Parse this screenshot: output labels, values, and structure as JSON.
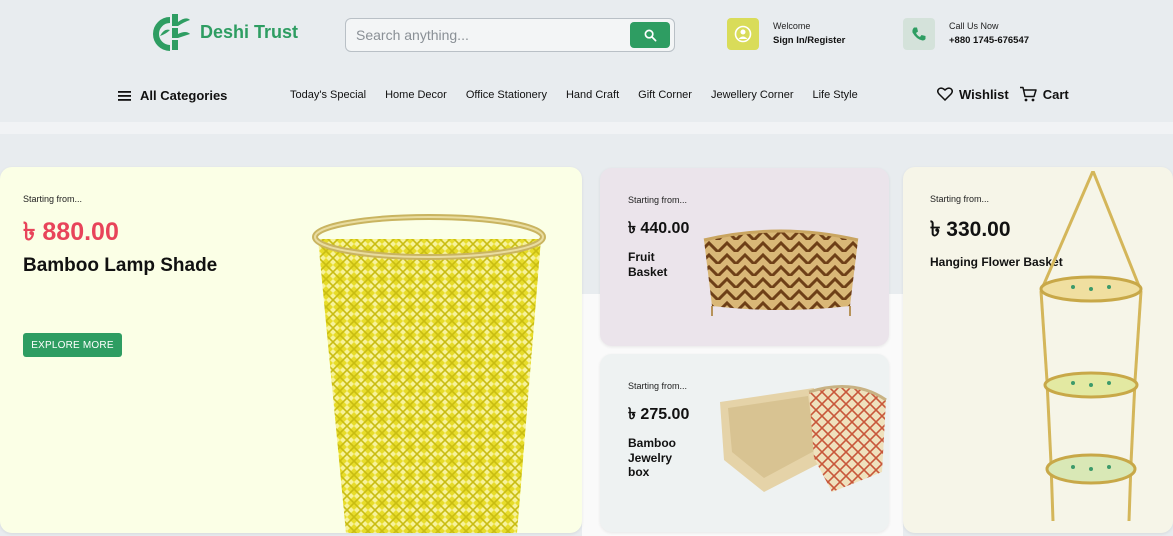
{
  "brand": {
    "name": "Deshi Trust"
  },
  "search": {
    "placeholder": "Search anything..."
  },
  "account": {
    "welcome": "Welcome",
    "action": "Sign In/Register"
  },
  "contact": {
    "label": "Call Us Now",
    "phone": "+880 1745-676547"
  },
  "nav": {
    "all_categories": "All Categories",
    "items": [
      "Today's Special",
      "Home Decor",
      "Office Stationery",
      "Hand Craft",
      "Gift Corner",
      "Jewellery Corner",
      "Life Style"
    ],
    "wishlist": "Wishlist",
    "cart": "Cart"
  },
  "promos": {
    "main": {
      "starting": "Starting from...",
      "price": "৳ 880.00",
      "title": "Bamboo Lamp Shade",
      "cta": "EXPLORE MORE"
    },
    "fruit": {
      "starting": "Starting from...",
      "price": "৳ 440.00",
      "title_line1": "Fruit",
      "title_line2": "Basket"
    },
    "jewelry": {
      "starting": "Starting from...",
      "price": "৳ 275.00",
      "title_line1": "Bamboo",
      "title_line2": "Jewelry",
      "title_line3": "box"
    },
    "hanging": {
      "starting": "Starting from...",
      "price": "৳ 330.00",
      "title": "Hanging Flower Basket"
    }
  },
  "colors": {
    "brand_green": "#2e9d62",
    "price_red": "#e8445a",
    "welcome_yellow": "#d9dc59"
  }
}
